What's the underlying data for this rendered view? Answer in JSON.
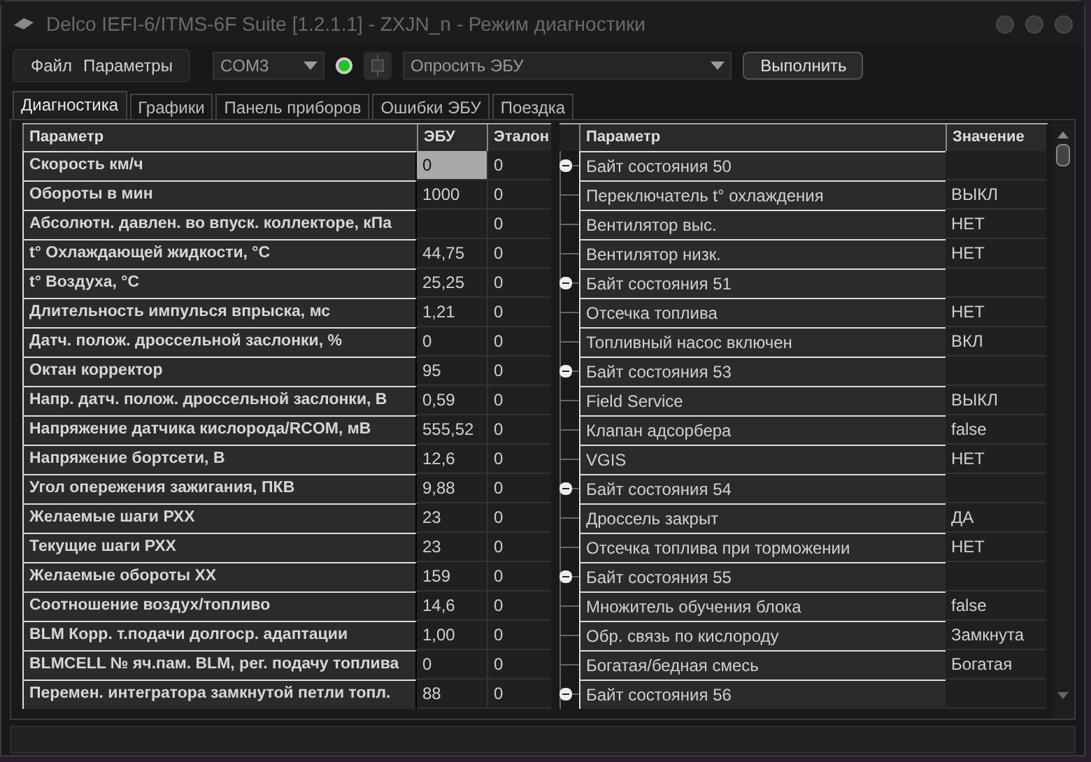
{
  "window": {
    "title": "Delco IEFI-6/ITMS-6F Suite [1.2.1.1] - ZXJN_n - Режим диагностики"
  },
  "menu": [
    "Файл",
    "Параметры"
  ],
  "port": {
    "value": "COM3"
  },
  "connection": {
    "on": true
  },
  "command": {
    "value": "Опросить ЭБУ"
  },
  "run_button": "Выполнить",
  "tabs": [
    {
      "label": "Диагностика",
      "selected": true
    },
    {
      "label": "Графики",
      "selected": false
    },
    {
      "label": "Панель приборов",
      "selected": false
    },
    {
      "label": "Ошибки ЭБУ",
      "selected": false
    },
    {
      "label": "Поездка",
      "selected": false
    }
  ],
  "left_table": {
    "columns": [
      "Параметр",
      "ЭБУ",
      "Эталон"
    ],
    "rows": [
      {
        "name": "Скорость км/ч",
        "ecu": "0",
        "ref": "0",
        "selected": true
      },
      {
        "name": "Обороты в мин",
        "ecu": "1000",
        "ref": "0",
        "selected": false
      },
      {
        "name": "Абсолютн. давлен. во впуск. коллекторе, кПа",
        "ref": "0",
        "selected": false
      },
      {
        "name": "t° Охлаждающей жидкости, °C",
        "ecu": "44,75",
        "ref": "0",
        "selected": false
      },
      {
        "name": "t° Воздуха, °C",
        "ecu": "25,25",
        "ref": "0",
        "selected": false
      },
      {
        "name": "Длительность импулься впрыска, мс",
        "ecu": "1,21",
        "ref": "0",
        "selected": false
      },
      {
        "name": "Датч. полож. дроссельной заслонки, %",
        "ecu": "0",
        "ref": "0",
        "selected": false
      },
      {
        "name": "Октан корректор",
        "ecu": "95",
        "ref": "0",
        "selected": false
      },
      {
        "name": "Напр. датч. полож. дроссельной заслонки, В",
        "ecu": "0,59",
        "ref": "0",
        "selected": false
      },
      {
        "name": "Напряжение датчика кислорода/RCOM, мВ",
        "ecu": "555,52",
        "ref": "0",
        "selected": false
      },
      {
        "name": "Напряжение бортсети, В",
        "ecu": "12,6",
        "ref": "0",
        "selected": false
      },
      {
        "name": "Угол опережения зажигания, ПКВ",
        "ecu": "9,88",
        "ref": "0",
        "selected": false
      },
      {
        "name": "Желаемые шаги РХХ",
        "ecu": "23",
        "ref": "0",
        "selected": false
      },
      {
        "name": "Текущие шаги РХХ",
        "ecu": "23",
        "ref": "0",
        "selected": false
      },
      {
        "name": "Желаемые обороты ХХ",
        "ecu": "159",
        "ref": "0",
        "selected": false
      },
      {
        "name": "Соотношение воздух/топливо",
        "ecu": "14,6",
        "ref": "0",
        "selected": false
      },
      {
        "name": "BLM Корр. т.подачи долгоср. адаптации",
        "ecu": "1,00",
        "ref": "0",
        "selected": false
      },
      {
        "name": "BLMCELL № яч.пам. BLM, рег. подачу топлива",
        "ecu": "0",
        "ref": "0",
        "selected": false
      },
      {
        "name": "Перемен. интегратора замкнутой петли топл.",
        "ecu": "88",
        "ref": "0",
        "selected": false
      }
    ]
  },
  "right_tree": {
    "columns": [
      "Параметр",
      "Значение"
    ],
    "groups": [
      {
        "name": "Байт состояния 50",
        "expanded": true,
        "children": [
          {
            "name": "Переключатель t° охлаждения",
            "value": "ВЫКЛ"
          },
          {
            "name": "Вентилятор выс.",
            "value": "НЕТ"
          },
          {
            "name": "Вентилятор низк.",
            "value": "НЕТ"
          }
        ]
      },
      {
        "name": "Байт состояния 51",
        "expanded": true,
        "children": [
          {
            "name": "Отсечка топлива",
            "value": "НЕТ"
          },
          {
            "name": "Топливный насос включен",
            "value": "ВКЛ"
          }
        ]
      },
      {
        "name": "Байт состояния 53",
        "expanded": true,
        "children": [
          {
            "name": "Field Service",
            "value": "ВЫКЛ"
          },
          {
            "name": "Клапан адсорбера",
            "value": "false"
          },
          {
            "name": "VGIS",
            "value": "НЕТ"
          }
        ]
      },
      {
        "name": "Байт состояния 54",
        "expanded": true,
        "children": [
          {
            "name": "Дроссель закрыт",
            "value": "ДА"
          },
          {
            "name": "Отсечка топлива при торможении",
            "value": "НЕТ"
          }
        ]
      },
      {
        "name": "Байт состояния 55",
        "expanded": true,
        "children": [
          {
            "name": "Множитель обучения блока",
            "value": "false"
          },
          {
            "name": "Обр. связь по кислороду",
            "value": "Замкнута"
          },
          {
            "name": "Богатая/бедная смесь",
            "value": "Богатая"
          }
        ]
      },
      {
        "name": "Байт состояния 56",
        "expanded": true
      }
    ]
  }
}
